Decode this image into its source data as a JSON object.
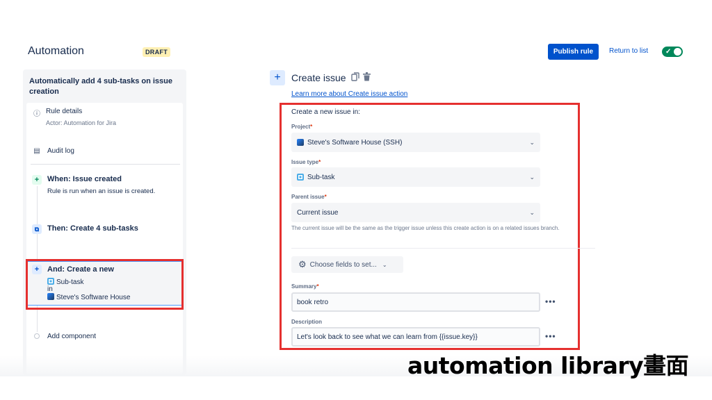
{
  "header": {
    "title": "Automation",
    "badge": "DRAFT",
    "publish_label": "Publish rule",
    "return_label": "Return to list",
    "enabled": true,
    "toggle_check": "✓"
  },
  "sidebar": {
    "rule_name": "Automatically add 4 sub-tasks on issue creation",
    "rule_details": {
      "label": "Rule details",
      "actor": "Actor: Automation for Jira"
    },
    "audit_log": "Audit log",
    "when": {
      "title": "When: Issue created",
      "desc": "Rule is run when an issue is created."
    },
    "then": {
      "title": "Then: Create 4 sub-tasks"
    },
    "and": {
      "title": "And: Create a new",
      "issue_type": "Sub-task",
      "in": "in",
      "project": "Steve's Software House"
    },
    "add_component": "Add component"
  },
  "editor": {
    "title": "Create issue",
    "learn_more": "Learn more about Create issue action",
    "create_in": "Create a new issue in:",
    "project_label": "Project",
    "project_value": "Steve's Software House (SSH)",
    "issue_type_label": "Issue type",
    "issue_type_value": "Sub-task",
    "parent_label": "Parent issue",
    "parent_value": "Current issue",
    "helper": "The current issue will be the same as the trigger issue unless this create action is on a related issues branch.",
    "choose_fields": "Choose fields to set...",
    "summary_label": "Summary",
    "summary_value": "book retro",
    "description_label": "Description",
    "description_value": "Let's look back to see what we can learn from {{issue.key}}",
    "required_mark": "*",
    "more": "•••"
  },
  "caption": "automation library畫面",
  "colors": {
    "brand": "#0052cc",
    "highlight": "#e5302f",
    "toggle_on": "#00875a"
  },
  "icons": [
    "info-icon",
    "audit-log-icon",
    "plus-icon",
    "subtasks-icon",
    "subtask-icon",
    "project-icon",
    "copy-icon",
    "trash-icon",
    "gear-icon",
    "chevron-down-icon",
    "more-icon"
  ]
}
